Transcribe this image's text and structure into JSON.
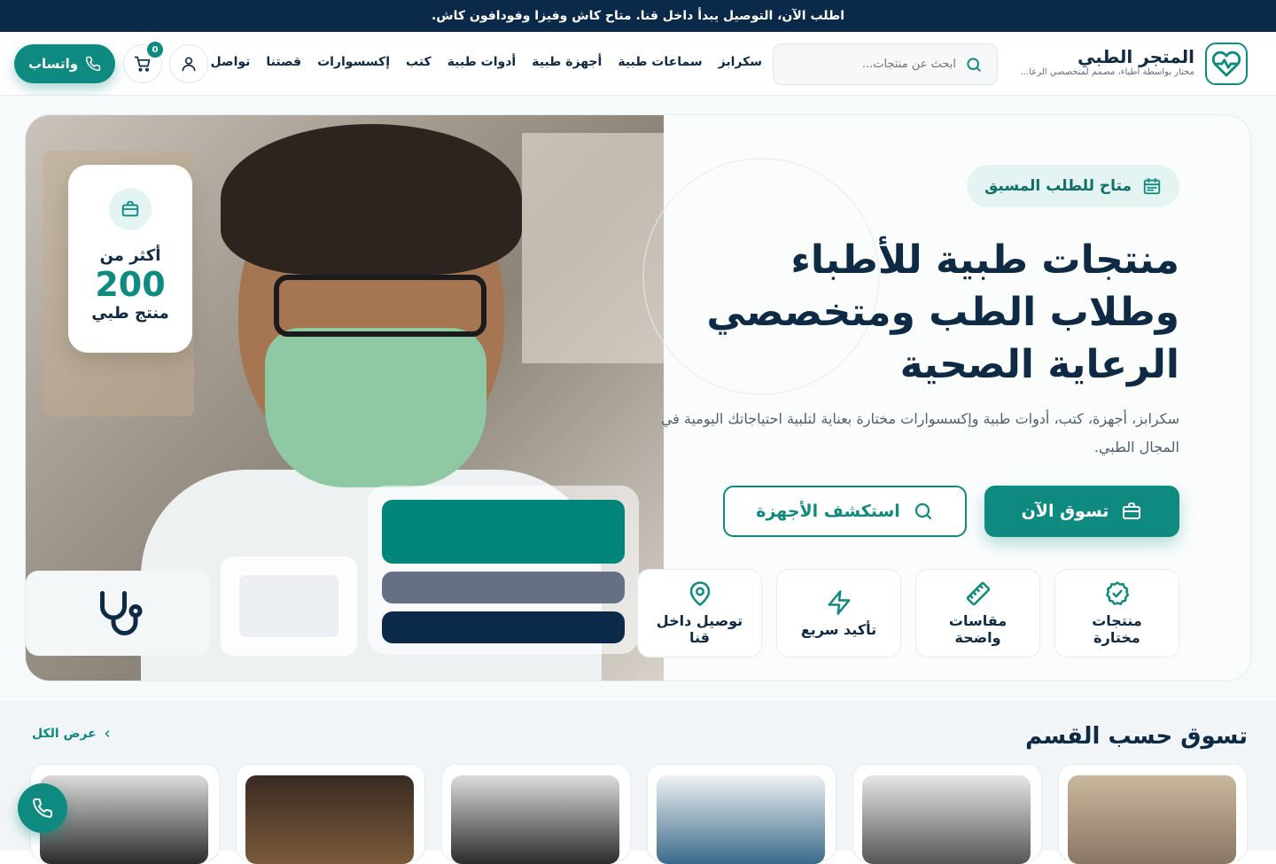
{
  "topbar": {
    "text": "اطلب الآن، التوصيل يبدأ داخل قنا. متاح كاش وفيزا وفودافون كاش."
  },
  "brand": {
    "name": "المتجر الطبي",
    "tagline": "مختار بواسطة أطباء، مصمم لمتخصصي الرعا...",
    "accent": "#0f8a80",
    "navy": "#0b2a4a"
  },
  "search": {
    "placeholder": "ابحث عن منتجات..."
  },
  "nav": [
    "سكرابز",
    "سماعات طبية",
    "أجهزة طبية",
    "أدوات طبية",
    "كتب",
    "إكسسوارات",
    "قصتنا",
    "تواصل معنا"
  ],
  "cart": {
    "count": "0"
  },
  "whatsapp": {
    "label": "واتساب"
  },
  "hero": {
    "badge": "متاح للطلب المسبق",
    "title": "منتجات طبية للأطباء وطلاب الطب ومتخصصي الرعاية الصحية",
    "description": "سكرابز، أجهزة، كتب، أدوات طبية وإكسسوارات مختارة بعناية لتلبية احتياجاتك اليومية في المجال الطبي.",
    "primary_button": "تسوق الآن",
    "secondary_button": "استكشف الأجهزة",
    "stat": {
      "top": "أكثر من",
      "number": "200",
      "bottom": "منتج طبي"
    },
    "swatches": [
      "#00857a",
      "#667085",
      "#0b2a4a"
    ],
    "features": [
      {
        "label": "منتجات مختارة",
        "icon": "badge-check-icon"
      },
      {
        "label": "مقاسات واضحة",
        "icon": "ruler-icon"
      },
      {
        "label": "تأكيد سريع",
        "icon": "zap-icon"
      },
      {
        "label": "توصيل داخل قنا",
        "icon": "map-pin-icon"
      }
    ]
  },
  "categories": {
    "title": "تسوق حسب القسم",
    "view_all": "عرض الكل"
  }
}
